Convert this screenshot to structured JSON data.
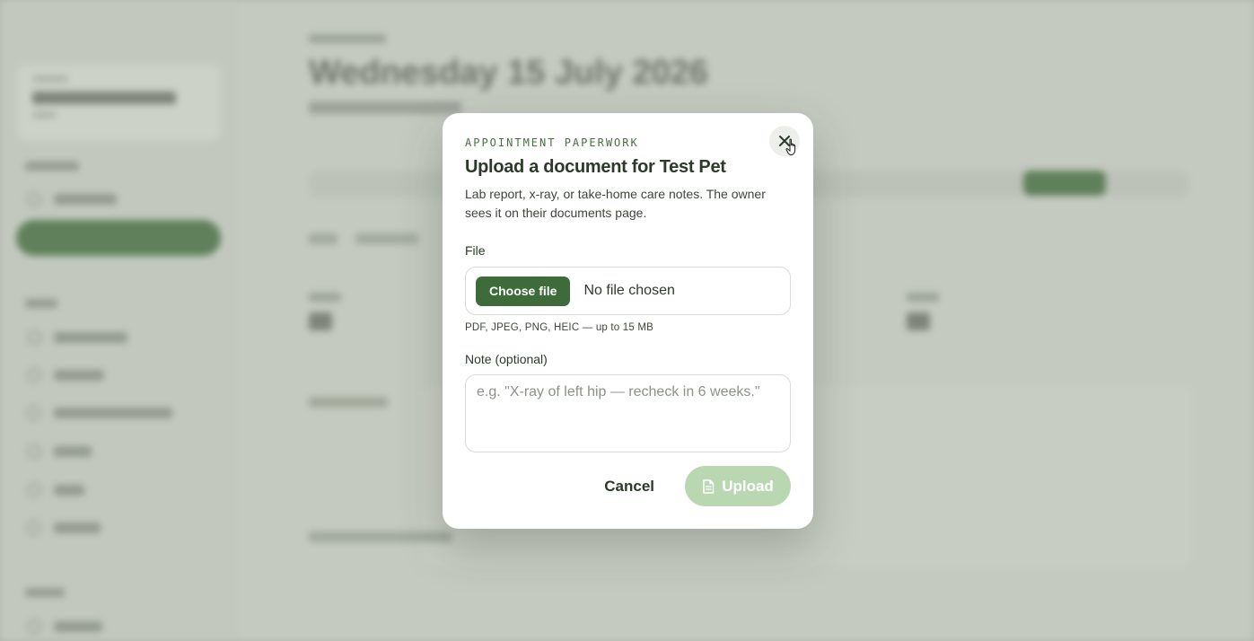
{
  "background": {
    "title": "Wednesday 15 July 2026"
  },
  "modal": {
    "eyebrow": "APPOINTMENT PAPERWORK",
    "title": "Upload a document for Test Pet",
    "description": "Lab report, x-ray, or take-home care notes. The owner sees it on their documents page.",
    "close_icon": "close-icon"
  },
  "file_field": {
    "label": "File",
    "choose_label": "Choose file",
    "status": "No file chosen",
    "hint": "PDF, JPEG, PNG, HEIC — up to 15 MB"
  },
  "note_field": {
    "label": "Note (optional)",
    "value": "",
    "placeholder": "e.g. \"X-ray of left hip — recheck in 6 weeks.\""
  },
  "actions": {
    "cancel_label": "Cancel",
    "upload_label": "Upload",
    "upload_icon": "document-icon"
  },
  "colors": {
    "brand": "#3e6b3a",
    "upload_disabled": "#b9d8b2",
    "eyebrow": "#4a6f45"
  }
}
